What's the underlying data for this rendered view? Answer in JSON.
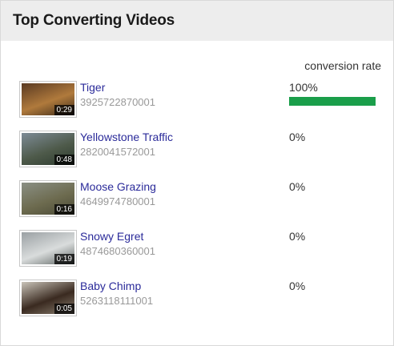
{
  "widget": {
    "title": "Top Converting Videos",
    "column_header": "conversion rate"
  },
  "videos": [
    {
      "title": "Tiger",
      "id": "3925722870001",
      "duration": "0:29",
      "rate_label": "100%",
      "rate": 1.0,
      "thumb_colors": [
        "#5a3a22",
        "#b07a3c",
        "#3c2a18"
      ]
    },
    {
      "title": "Yellowstone Traffic",
      "id": "2820041572001",
      "duration": "0:48",
      "rate_label": "0%",
      "rate": 0.0,
      "thumb_colors": [
        "#7d8b96",
        "#4e5a4a",
        "#2c3a2e"
      ]
    },
    {
      "title": "Moose Grazing",
      "id": "4649974780001",
      "duration": "0:16",
      "rate_label": "0%",
      "rate": 0.0,
      "thumb_colors": [
        "#8a8f84",
        "#6d6b4f",
        "#4a4a36"
      ]
    },
    {
      "title": "Snowy Egret",
      "id": "4874680360001",
      "duration": "0:19",
      "rate_label": "0%",
      "rate": 0.0,
      "thumb_colors": [
        "#9aa0a3",
        "#d9dcdc",
        "#5d6462"
      ]
    },
    {
      "title": "Baby Chimp",
      "id": "5263118111001",
      "duration": "0:05",
      "rate_label": "0%",
      "rate": 0.0,
      "thumb_colors": [
        "#c9c3b8",
        "#3a2a20",
        "#8a7f70"
      ]
    }
  ],
  "colors": {
    "bar_fill": "#1a9e4a",
    "link": "#2b2b9a"
  }
}
